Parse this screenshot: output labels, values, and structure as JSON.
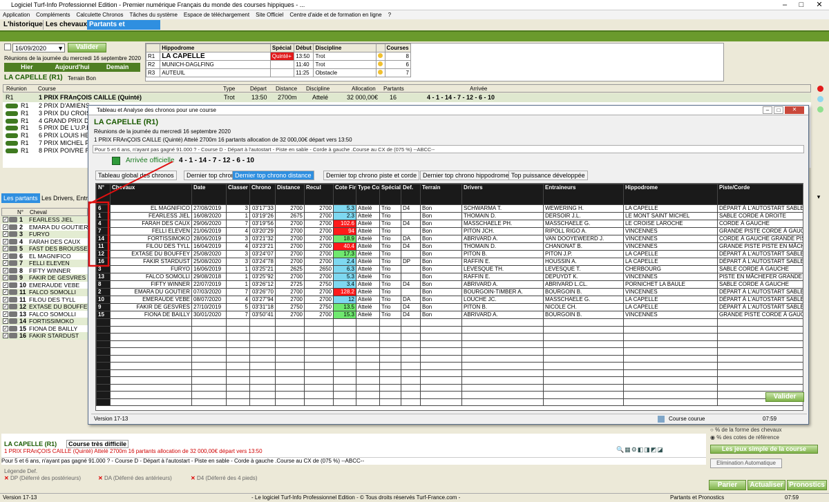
{
  "window": {
    "title": "Logiciel Turf-Info Professionnel Edition - Premier numérique Français du monde des courses hippiques - ..."
  },
  "menu": [
    "Application",
    "Compléments",
    "Calculette Chronos",
    "Tâches du système",
    "Espace de téléchargement",
    "Site Officiel",
    "Centre d'aide et de formation en ligne",
    "?"
  ],
  "main_tabs": [
    "L'historique",
    "Les chevaux",
    "Partants et Pronostics"
  ],
  "date": {
    "value": "16/09/2020",
    "valider": "Valider",
    "reunions": "Réunions de la journée du mercredi 16 septembre 2020",
    "hier": "Hier",
    "aujourdhui": "Aujourd'hui",
    "demain": "Demain"
  },
  "race_head": {
    "name": "LA CAPELLE (R1)",
    "terrain": "Terrain Bon"
  },
  "hippodromes": {
    "headers": [
      "Hippodrome",
      "Spécial",
      "Début",
      "Discipline",
      "Courses"
    ],
    "rows": [
      {
        "r": "R1",
        "name": "LA CAPELLE",
        "special": "Quinté+",
        "debut": "13:50",
        "disc": "Trot",
        "courses": "8"
      },
      {
        "r": "R2",
        "name": "MUNICH-DAGLFING",
        "special": "",
        "debut": "11:40",
        "disc": "Trot",
        "courses": "6"
      },
      {
        "r": "R3",
        "name": "AUTEUIL",
        "special": "",
        "debut": "11:25",
        "disc": "Obstacle",
        "courses": "7"
      }
    ]
  },
  "courses": {
    "headers": [
      "Réunion",
      "Course",
      "Type",
      "Départ",
      "Distance",
      "Discipline",
      "Allocation",
      "Partants",
      "Arrivée"
    ],
    "first": {
      "r": "R1",
      "course": "1 PRIX FRAnÇOIS CAILLE (Quinté)",
      "type": "Trot",
      "depart": "13:50",
      "distance": "2700m",
      "disc": "Attelé",
      "alloc": "32 000,00€",
      "partants": "16",
      "arrivee": "4 - 1 - 14 - 7 - 12 - 6 - 10"
    },
    "others": [
      {
        "r": "R1",
        "course": "2 PRIX D'AMIENS"
      },
      {
        "r": "R1",
        "course": "3 PRIX DU CROISE"
      },
      {
        "r": "R1",
        "course": "4 GRAND PRIX DE"
      },
      {
        "r": "R1",
        "course": "5 PRIX DE L'U.P.E"
      },
      {
        "r": "R1",
        "course": "6 PRIX LOUIS HEN"
      },
      {
        "r": "R1",
        "course": "7 PRIX MICHEL FL"
      },
      {
        "r": "R1",
        "course": "8 PRIX POIVRE RO"
      }
    ]
  },
  "left_tabs": [
    "Les partants",
    "Les Drivers, Entra"
  ],
  "partants_header": [
    "N°",
    "Cheval"
  ],
  "partants": [
    {
      "n": "1",
      "name": "FEARLESS JIEL"
    },
    {
      "n": "2",
      "name": "EMARA DU GOUTIER"
    },
    {
      "n": "3",
      "name": "FURYO"
    },
    {
      "n": "4",
      "name": "FARAH DES CAUX"
    },
    {
      "n": "5",
      "name": "FAST DES BROUSSE"
    },
    {
      "n": "6",
      "name": "EL MAGNIFICO"
    },
    {
      "n": "7",
      "name": "FELLI ELEVEN"
    },
    {
      "n": "8",
      "name": "FIFTY WINNER"
    },
    {
      "n": "9",
      "name": "FAKIR DE GESVRES"
    },
    {
      "n": "10",
      "name": "EMERAUDE VEBE"
    },
    {
      "n": "11",
      "name": "FALCO SOMOLLI"
    },
    {
      "n": "11",
      "name": "FILOU DES TYLL"
    },
    {
      "n": "12",
      "name": "EXTASE DU BOUFFEY"
    },
    {
      "n": "13",
      "name": "FALCO SOMOLLI"
    },
    {
      "n": "14",
      "name": "FORTISSIMOKO"
    },
    {
      "n": "15",
      "name": "FIONA DE BAILLY"
    },
    {
      "n": "16",
      "name": "FAKIR STARDUST"
    }
  ],
  "dialog": {
    "title": "Tableau et Analyse des chronos pour une course",
    "race": "LA CAPELLE (R1)",
    "reunions": "Réunions de la journée du mercredi 16 septembre 2020",
    "summary": "1 PRIX FRAnÇOIS CAILLE (Quinté) Attelé 2700m 16 partants allocation de 32 000,00€ départ vers 13:50",
    "conditions": "Pour 5 et 6 ans, n'ayant pas gagné 91.000 ? - Course D - Départ à l'autostart - Piste en sable - Corde à gauche .Course au CX de (075 %)  --ABCC--",
    "arrivee_label": "Arrivée officielle",
    "arrivee": "4 - 1 - 14 - 7 - 12 - 6 - 10",
    "tabs": [
      "Tableau global des chronos",
      "Dernier top chrono",
      "Dernier top chrono distance",
      "Dernier top chrono piste et corde",
      "Dernier top chrono hippodrome",
      "Top puissance développée"
    ],
    "active_tab": 2,
    "headers": [
      "N°",
      "Chevaux",
      "Date",
      "Classer",
      "Chrono",
      "Distance",
      "Recul",
      "Cote Fin",
      "Type Course",
      "Spécial",
      "Def.",
      "Terrain",
      "Drivers",
      "Entraineurs",
      "Hippodrome",
      "Piste/Corde"
    ],
    "rows": [
      [
        "6",
        "EL MAGNIFICO",
        "27/08/2019",
        "3",
        "03'17\"33",
        "2700",
        "2700",
        "5.3",
        "Attelé",
        "Trio",
        "D4",
        "Bon",
        "SCHWARMA T.",
        "WEWERING H.",
        "LA CAPELLE",
        "DÉPART À L'AUTOSTART SABLE"
      ],
      [
        "1",
        "FEARLESS JIEL",
        "16/08/2020",
        "1",
        "03'19\"26",
        "2675",
        "2700",
        "2.3",
        "Attelé",
        "Trio",
        "",
        "Bon",
        "THOMAIN D.",
        "DERSOIR J.L.",
        "LE MONT SAINT MICHEL",
        "SABLE CORDE À DROITE"
      ],
      [
        "4",
        "FARAH DES CAUX",
        "29/06/2020",
        "7",
        "03'19\"56",
        "2700",
        "2700",
        "102.6",
        "Attelé",
        "Trio",
        "D4",
        "Bon",
        "MASSCHAELE PH.",
        "MASSCHAELE G.",
        "LE CROISE LAROCHE",
        "CORDE À GAUCHE"
      ],
      [
        "7",
        "FELLI ELEVEN",
        "21/06/2019",
        "4",
        "03'20\"29",
        "2700",
        "2700",
        "94",
        "Attelé",
        "Trio",
        "",
        "Bon",
        "PITON JCH.",
        "RIPOLL RIGO A.",
        "VINCENNES",
        "GRANDE PISTE CORDE À GAUCHE"
      ],
      [
        "14",
        "FORTISSIMOKO",
        "28/06/2019",
        "3",
        "03'21\"32",
        "2700",
        "2700",
        "18.9",
        "Attelé",
        "Trio",
        "DA",
        "Bon",
        "ABRIVARD A.",
        "VAN DOOYEWEERD J.",
        "VINCENNES",
        "CORDE À GAUCHE GRANDE PISTE"
      ],
      [
        "11",
        "FILOU DES TYLL",
        "16/04/2019",
        "4",
        "03'23\"21",
        "2700",
        "2700",
        "40.4",
        "Attelé",
        "Trio",
        "D4",
        "Bon",
        "THOMAIN D.",
        "CHANONAT B.",
        "VINCENNES",
        "GRANDE PISTE PISTE EN MÂCHEFER"
      ],
      [
        "12",
        "EXTASE DU BOUFFEY",
        "25/08/2020",
        "3",
        "03'24\"07",
        "2700",
        "2700",
        "17.3",
        "Attelé",
        "Trio",
        "",
        "Bon",
        "PITON B.",
        "PITON J.P.",
        "LA CAPELLE",
        "DÉPART À L'AUTOSTART SABLE"
      ],
      [
        "16",
        "FAKIR STARDUST",
        "25/08/2020",
        "3",
        "03'24\"78",
        "2700",
        "2700",
        "2.4",
        "Attelé",
        "Trio",
        "DP",
        "Bon",
        "RAFFIN E.",
        "HOUSSIN A.",
        "LA CAPELLE",
        "DÉPART À L'AUTOSTART SABLE"
      ],
      [
        "3",
        "FURYO",
        "16/06/2019",
        "1",
        "03'25\"21",
        "2625",
        "2650",
        "6.3",
        "Attelé",
        "Trio",
        "",
        "Bon",
        "LEVESQUE TH.",
        "LEVESQUE T.",
        "CHERBOURG",
        "SABLE CORDE À GAUCHE"
      ],
      [
        "13",
        "FALCO SOMOLLI",
        "29/08/2018",
        "1",
        "03'25\"92",
        "2700",
        "2700",
        "5.3",
        "Attelé",
        "Trio",
        "",
        "Bon",
        "RAFFIN E.",
        "DEPUYDT K.",
        "VINCENNES",
        "PISTE EN MÂCHEFER GRANDE"
      ],
      [
        "8",
        "FIFTY WINNER",
        "22/07/2019",
        "1",
        "03'26\"12",
        "2725",
        "2750",
        "3.4",
        "Attelé",
        "Trio",
        "D4",
        "Bon",
        "ABRIVARD A.",
        "ABRIVARD L.CL.",
        "PORNICHET LA BAULE",
        "SABLE CORDE À GAUCHE"
      ],
      [
        "2",
        "EMARA DU GOUTIER",
        "07/03/2020",
        "7",
        "03'26\"70",
        "2700",
        "2700",
        "128.2",
        "Attelé",
        "Trio",
        "",
        "Bon",
        "BOURGOIN-TIMBER A.",
        "BOURGOIN B.",
        "VINCENNES",
        "DÉPART À L'AUTOSTART SABLE"
      ],
      [
        "10",
        "EMERAUDE VEBE",
        "08/07/2020",
        "4",
        "03'27\"94",
        "2700",
        "2700",
        "12",
        "Attelé",
        "Trio",
        "DA",
        "Bon",
        "LOUCHE JC.",
        "MASSCHAELE G.",
        "LA CAPELLE",
        "DÉPART À L'AUTOSTART SABLE"
      ],
      [
        "9",
        "FAKIR DE GESVRES",
        "27/10/2019",
        "5",
        "03'31\"18",
        "2750",
        "2750",
        "13.5",
        "Attelé",
        "Trio",
        "D4",
        "Bon",
        "PITON B.",
        "NICOLE CH.",
        "LA CAPELLE",
        "DÉPART À L'AUTOSTART SABLE"
      ],
      [
        "15",
        "FIONA DE BAILLY",
        "30/01/2020",
        "7",
        "03'50\"41",
        "2700",
        "2700",
        "15.3",
        "Attelé",
        "Trio",
        "D4",
        "Bon",
        "ABRIVARD A.",
        "BOURGOIN B.",
        "VINCENNES",
        "GRANDE PISTE CORDE À GAUCHE"
      ]
    ],
    "cote_colors": [
      "cb",
      "cb",
      "cr",
      "cr",
      "cg",
      "cr",
      "cg",
      "cb",
      "cb",
      "cb",
      "cb",
      "cr",
      "cb",
      "cg",
      "cg"
    ],
    "valider": "Valider",
    "version": "Version 17-13",
    "status": "Course courue",
    "time": "07:59"
  },
  "bottom": {
    "race": "LA CAPELLE (R1)",
    "difficulty": "Course très difficile",
    "summary": "1 PRIX FRAnÇOIS CAILLE (Quinté) Attelé 2700m 16 partants allocation de 32 000,00€ départ vers 13:50",
    "conditions": "Pour 5 et 6 ans, n'ayant pas gagné 91.000 ? - Course D - Départ à l'autostart - Piste en sable - Corde à gauche .Course au CX de (075 %)  --ABCC--",
    "legende": "Légende Def.",
    "dp": "DP (Déferré des postérieurs)",
    "da": "DA (Déferré des antérieurs)",
    "d4": "D4 (Déferré des 4 pieds)",
    "radio1": "% de la forme des chevaux",
    "radio2": "% des cotes de référence",
    "jeux": "Les jeux simple de la course",
    "elim": "Elimination Automatique",
    "parier": "Parier",
    "actualiser": "Actualiser",
    "pronostics": "Pronostics"
  },
  "statusbar": {
    "version": "Version 17-13",
    "copyright": "- Le logiciel Turf-Info Professionnel Edition - © Tous droits réservés Turf-France.com -",
    "section": "Partants et Pronostics",
    "time": "07:59"
  }
}
